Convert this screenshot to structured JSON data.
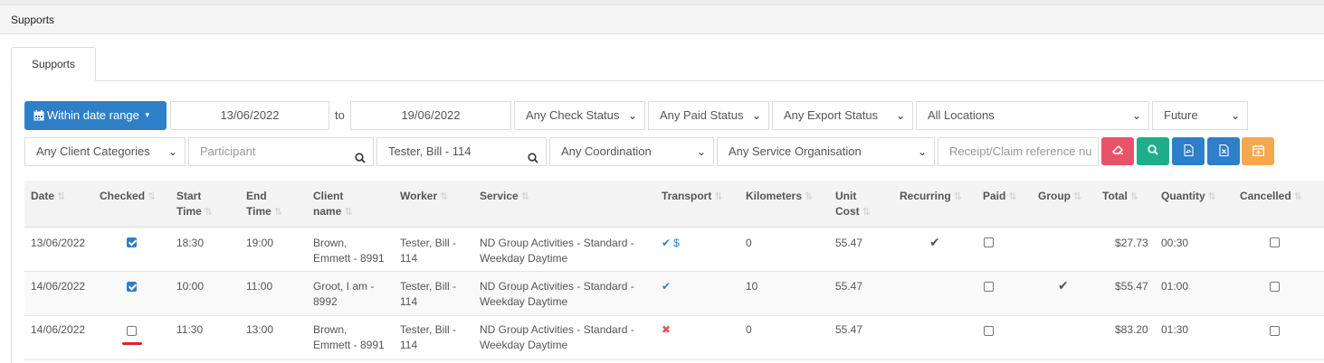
{
  "header": {
    "title": "Supports"
  },
  "tabs": [
    {
      "label": "Supports"
    }
  ],
  "filters": {
    "date_range_button": "Within date range",
    "date_from": "13/06/2022",
    "to_label": "to",
    "date_to": "19/06/2022",
    "check_status": "Any Check Status",
    "paid_status": "Any Paid Status",
    "export_status": "Any Export Status",
    "locations": "All Locations",
    "period": "Future",
    "client_categories": "Any Client Categories",
    "participant_placeholder": "Participant",
    "worker": "Tester, Bill - 114",
    "coordination": "Any Coordination",
    "service_organisation": "Any Service Organisation",
    "reference_placeholder": "Receipt/Claim reference nu"
  },
  "action_buttons": [
    {
      "name": "clear-filters-button",
      "icon": "eraser-icon",
      "color": "#e9536a"
    },
    {
      "name": "search-button",
      "icon": "search-icon",
      "color": "#1fae8b"
    },
    {
      "name": "export-pdf-button",
      "icon": "pdf-file-icon",
      "color": "#2e7fc8"
    },
    {
      "name": "export-excel-button",
      "icon": "excel-file-icon",
      "color": "#2e7fc8"
    },
    {
      "name": "add-to-calendar-button",
      "icon": "calendar-plus-icon",
      "color": "#f5a84e"
    }
  ],
  "table": {
    "headers": {
      "date": "Date",
      "checked": "Checked",
      "start_time_1": "Start",
      "start_time_2": "Time",
      "end_time_1": "End",
      "end_time_2": "Time",
      "client_name_1": "Client",
      "client_name_2": "name",
      "worker": "Worker",
      "service": "Service",
      "transport": "Transport",
      "kilometers": "Kilometers",
      "unit_cost_1": "Unit",
      "unit_cost_2": "Cost",
      "recurring": "Recurring",
      "paid": "Paid",
      "group": "Group",
      "total": "Total",
      "quantity": "Quantity",
      "cancelled": "Cancelled"
    },
    "rows": [
      {
        "date": "13/06/2022",
        "checked": true,
        "start": "18:30",
        "end": "19:00",
        "client_1": "Brown,",
        "client_2": "Emmett - 8991",
        "worker_1": "Tester, Bill -",
        "worker_2": "114",
        "service_1": "ND Group Activities - Standard -",
        "service_2": "Weekday Daytime",
        "transport": "tick-dollar",
        "transport_dollar": "$",
        "kilometers": "0",
        "unit_cost": "55.47",
        "recurring": true,
        "paid": false,
        "group": false,
        "total": "$27.73",
        "quantity": "00:30",
        "cancelled": false
      },
      {
        "date": "14/06/2022",
        "checked": true,
        "start": "10:00",
        "end": "11:00",
        "client_1": "Groot, I am -",
        "client_2": "8992",
        "worker_1": "Tester, Bill -",
        "worker_2": "114",
        "service_1": "ND Group Activities - Standard -",
        "service_2": "Weekday Daytime",
        "transport": "tick",
        "kilometers": "10",
        "unit_cost": "55.47",
        "recurring": false,
        "paid": false,
        "group": true,
        "total": "$55.47",
        "quantity": "01:00",
        "cancelled": false
      },
      {
        "date": "14/06/2022",
        "checked": false,
        "start": "11:30",
        "end": "13:00",
        "client_1": "Brown,",
        "client_2": "Emmett - 8991",
        "worker_1": "Tester, Bill -",
        "worker_2": "114",
        "service_1": "ND Group Activities - Standard -",
        "service_2": "Weekday Daytime",
        "transport": "cross",
        "kilometers": "0",
        "unit_cost": "55.47",
        "recurring": false,
        "paid": false,
        "group": false,
        "total": "$83.20",
        "quantity": "01:30",
        "cancelled": false
      }
    ]
  },
  "colors": {
    "primary": "#2e7fc8",
    "danger": "#e9536a",
    "success": "#1fae8b",
    "warning": "#f5a84e",
    "highlight": "#e02424"
  }
}
